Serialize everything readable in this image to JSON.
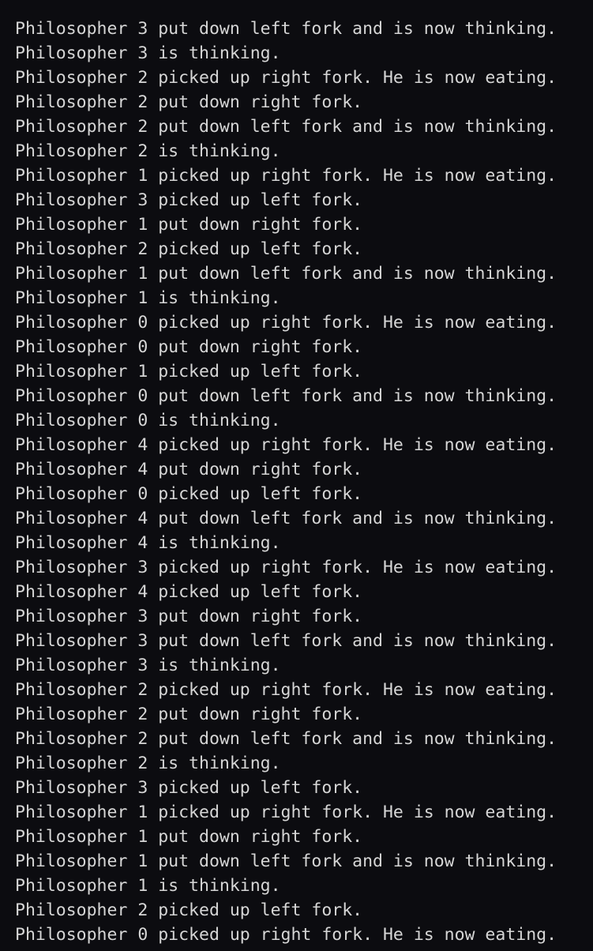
{
  "terminal": {
    "lines": [
      "Philosopher 3 put down left fork and is now thinking.",
      "Philosopher 3 is thinking.",
      "Philosopher 2 picked up right fork. He is now eating.",
      "Philosopher 2 put down right fork.",
      "Philosopher 2 put down left fork and is now thinking.",
      "Philosopher 2 is thinking.",
      "Philosopher 1 picked up right fork. He is now eating.",
      "Philosopher 3 picked up left fork.",
      "Philosopher 1 put down right fork.",
      "Philosopher 2 picked up left fork.",
      "Philosopher 1 put down left fork and is now thinking.",
      "Philosopher 1 is thinking.",
      "Philosopher 0 picked up right fork. He is now eating.",
      "Philosopher 0 put down right fork.",
      "Philosopher 1 picked up left fork.",
      "Philosopher 0 put down left fork and is now thinking.",
      "Philosopher 0 is thinking.",
      "Philosopher 4 picked up right fork. He is now eating.",
      "Philosopher 4 put down right fork.",
      "Philosopher 0 picked up left fork.",
      "Philosopher 4 put down left fork and is now thinking.",
      "Philosopher 4 is thinking.",
      "Philosopher 3 picked up right fork. He is now eating.",
      "Philosopher 4 picked up left fork.",
      "Philosopher 3 put down right fork.",
      "Philosopher 3 put down left fork and is now thinking.",
      "Philosopher 3 is thinking.",
      "Philosopher 2 picked up right fork. He is now eating.",
      "Philosopher 2 put down right fork.",
      "Philosopher 2 put down left fork and is now thinking.",
      "Philosopher 2 is thinking.",
      "Philosopher 3 picked up left fork.",
      "Philosopher 1 picked up right fork. He is now eating.",
      "Philosopher 1 put down right fork.",
      "Philosopher 1 put down left fork and is now thinking.",
      "Philosopher 1 is thinking.",
      "Philosopher 2 picked up left fork.",
      "Philosopher 0 picked up right fork. He is now eating."
    ]
  }
}
